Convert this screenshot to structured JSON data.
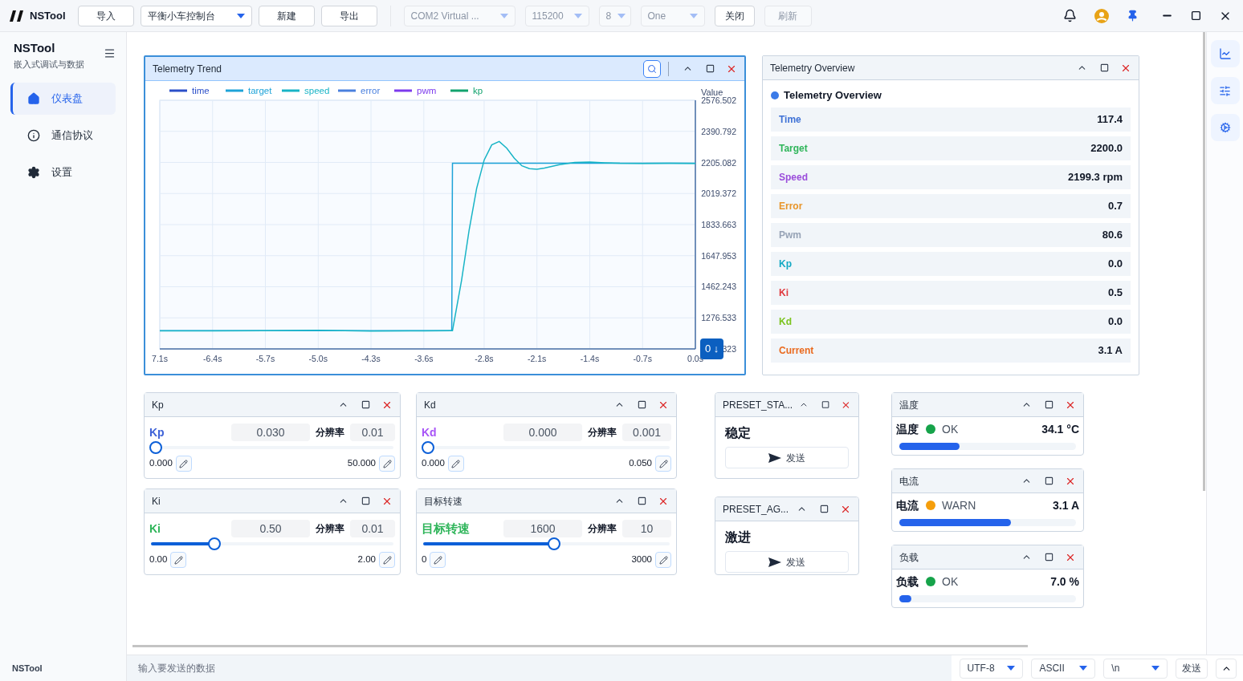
{
  "app": {
    "name": "NSTool"
  },
  "toolbar": [
    {
      "kind": "button",
      "label": "导入",
      "disabled": false
    },
    {
      "kind": "select",
      "value": "平衡小车控制台",
      "disabled": false
    },
    {
      "kind": "button",
      "label": "新建",
      "disabled": false
    },
    {
      "kind": "button",
      "label": "导出",
      "disabled": false
    }
  ],
  "serial": [
    {
      "kind": "select",
      "value": "COM2  Virtual ...",
      "disabled": true
    },
    {
      "kind": "select",
      "value": "115200",
      "disabled": true
    },
    {
      "kind": "select",
      "value": "8",
      "disabled": true
    },
    {
      "kind": "select",
      "value": "One",
      "disabled": true
    },
    {
      "kind": "button",
      "label": "关闭",
      "disabled": false
    },
    {
      "kind": "button",
      "label": "刷新",
      "disabled": true
    }
  ],
  "sidebar": {
    "title": "NSTool",
    "subtitle": "嵌入式调试与数据",
    "items": [
      {
        "label": "仪表盘",
        "selected": true
      },
      {
        "label": "通信协议",
        "selected": false
      },
      {
        "label": "设置",
        "selected": false
      }
    ],
    "footer": "NSTool"
  },
  "trend": {
    "title": "Telemetry Trend",
    "selected": true,
    "reset_button": "0 ↓",
    "covered_tick_text": "323",
    "chart_data": {
      "type": "line",
      "ylabel": "Value",
      "grid": true,
      "legend": true,
      "x": [
        -7.1,
        -6.4,
        -5.7,
        -5.0,
        -4.3,
        -3.6,
        -3.23,
        -3.22,
        -3.1,
        -3.0,
        -2.9,
        -2.8,
        -2.7,
        -2.6,
        -2.5,
        -2.4,
        -2.3,
        -2.2,
        -2.1,
        -2.0,
        -1.8,
        -1.6,
        -1.4,
        -1.2,
        -1.0,
        -0.7,
        -0.35,
        0.0
      ],
      "series": [
        {
          "name": "time",
          "color": "#2b4fc9",
          "values": [
            null,
            null,
            null,
            null,
            null,
            null,
            null,
            null,
            null,
            null,
            null,
            null,
            null,
            null,
            null,
            null,
            null,
            null,
            null,
            null,
            null,
            null,
            null,
            null,
            null,
            null,
            null,
            null
          ]
        },
        {
          "name": "target",
          "color": "#1ea3d8",
          "values": [
            1200,
            1200,
            1200,
            1200,
            1200,
            1200,
            1200,
            2200,
            2200,
            2200,
            2200,
            2200,
            2200,
            2200,
            2200,
            2200,
            2200,
            2200,
            2200,
            2200,
            2200,
            2200,
            2200,
            2200,
            2200,
            2200,
            2200,
            2200
          ]
        },
        {
          "name": "speed",
          "color": "#18b4c6",
          "values": [
            1198,
            1199,
            1200,
            1202,
            1197,
            1199,
            1200,
            1200,
            1500,
            1800,
            2050,
            2220,
            2310,
            2330,
            2290,
            2230,
            2185,
            2168,
            2165,
            2172,
            2192,
            2205,
            2208,
            2203,
            2200,
            2199,
            2200,
            2199
          ]
        },
        {
          "name": "error",
          "color": "#4a80de",
          "values": [
            null,
            null,
            null,
            null,
            null,
            null,
            null,
            null,
            null,
            null,
            null,
            null,
            null,
            null,
            null,
            null,
            null,
            null,
            null,
            null,
            null,
            null,
            null,
            null,
            null,
            null,
            null,
            null
          ]
        },
        {
          "name": "pwm",
          "color": "#7c3aed",
          "values": [
            null,
            null,
            null,
            null,
            null,
            null,
            null,
            null,
            null,
            null,
            null,
            null,
            null,
            null,
            null,
            null,
            null,
            null,
            null,
            null,
            null,
            null,
            null,
            null,
            null,
            null,
            null,
            null
          ]
        },
        {
          "name": "kp",
          "color": "#12a36e",
          "values": [
            null,
            null,
            null,
            null,
            null,
            null,
            null,
            null,
            null,
            null,
            null,
            null,
            null,
            null,
            null,
            null,
            null,
            null,
            null,
            null,
            null,
            null,
            null,
            null,
            null,
            null,
            null,
            null
          ]
        }
      ],
      "xlim": [
        -7.1,
        0
      ],
      "ylim": [
        1090.823,
        2576.502
      ],
      "xticks": [
        {
          "value": -7.1,
          "label": "7.1s"
        },
        {
          "value": -6.4,
          "label": "-6.4s"
        },
        {
          "value": -5.7,
          "label": "-5.7s"
        },
        {
          "value": -5.0,
          "label": "-5.0s"
        },
        {
          "value": -4.3,
          "label": "-4.3s"
        },
        {
          "value": -3.6,
          "label": "-3.6s"
        },
        {
          "value": -2.8,
          "label": "-2.8s"
        },
        {
          "value": -2.1,
          "label": "-2.1s"
        },
        {
          "value": -1.4,
          "label": "-1.4s"
        },
        {
          "value": -0.7,
          "label": "-0.7s"
        },
        {
          "value": 0,
          "label": "0.0s"
        }
      ],
      "yticks": [
        {
          "value": 1276.533,
          "label": "1276.533"
        },
        {
          "value": 1462.243,
          "label": "1462.243"
        },
        {
          "value": 1647.953,
          "label": "1647.953"
        },
        {
          "value": 1833.663,
          "label": "1833.663"
        },
        {
          "value": 2019.372,
          "label": "2019.372"
        },
        {
          "value": 2205.082,
          "label": "2205.082"
        },
        {
          "value": 2390.792,
          "label": "2390.792"
        },
        {
          "value": 2576.502,
          "label": "2576.502"
        }
      ]
    }
  },
  "overview": {
    "title": "Telemetry Overview",
    "selected": false,
    "heading": "Telemetry Overview",
    "rows": [
      {
        "label": "Time",
        "value": "117.4",
        "color": "#3f72d6"
      },
      {
        "label": "Target",
        "value": "2200.0",
        "color": "#2fb55a"
      },
      {
        "label": "Speed",
        "value": "2199.3 rpm",
        "color": "#9b4ddb"
      },
      {
        "label": "Error",
        "value": "0.7",
        "color": "#e8952a"
      },
      {
        "label": "Pwm",
        "value": "80.6",
        "color": "#97a3b6"
      },
      {
        "label": "Kp",
        "value": "0.0",
        "color": "#14a9c4"
      },
      {
        "label": "Ki",
        "value": "0.5",
        "color": "#e0393e"
      },
      {
        "label": "Kd",
        "value": "0.0",
        "color": "#7cc420"
      },
      {
        "label": "Current",
        "value": "3.1 A",
        "color": "#ea6a1e"
      }
    ]
  },
  "params": [
    {
      "title": "Kp",
      "label": "Kp",
      "color": "#3f63d8",
      "value": "0.030",
      "resolution_label": "分辨率",
      "resolution": "0.01",
      "level": 0.0006,
      "min": "0.000",
      "max": "50.000"
    },
    {
      "title": "Ki",
      "label": "Ki",
      "color": "#2fb55a",
      "value": "0.50",
      "resolution_label": "分辨率",
      "resolution": "0.01",
      "level": 0.25,
      "min": "0.00",
      "max": "2.00"
    },
    {
      "title": "Kd",
      "label": "Kd",
      "color": "#a855f7",
      "value": "0.000",
      "resolution_label": "分辨率",
      "resolution": "0.001",
      "level": 0,
      "min": "0.000",
      "max": "0.050"
    },
    {
      "title": "目标转速",
      "label": "目标转速",
      "color": "#2fb55a",
      "value": "1600",
      "resolution_label": "分辨率",
      "resolution": "10",
      "level": 0.533,
      "min": "0",
      "max": "3000"
    }
  ],
  "presets": [
    {
      "title": "PRESET_STA...",
      "label": "稳定",
      "button": "发送"
    },
    {
      "title": "PRESET_AG...",
      "label": "激进",
      "button": "发送"
    }
  ],
  "gauges": [
    {
      "title": "温度",
      "label": "温度",
      "status": "OK",
      "color": "#16a34a",
      "value": "34.1 °C",
      "level": 0.34
    },
    {
      "title": "电流",
      "label": "电流",
      "status": "WARN",
      "color": "#f59e0b",
      "value": "3.1 A",
      "level": 0.63
    },
    {
      "title": "负载",
      "label": "负载",
      "status": "OK",
      "color": "#16a34a",
      "value": "7.0 %",
      "level": 0.07
    }
  ],
  "sendbar": {
    "placeholder": "输入要发送的数据",
    "selects": [
      "UTF-8",
      "ASCII",
      "\\n"
    ],
    "send": "发送"
  }
}
